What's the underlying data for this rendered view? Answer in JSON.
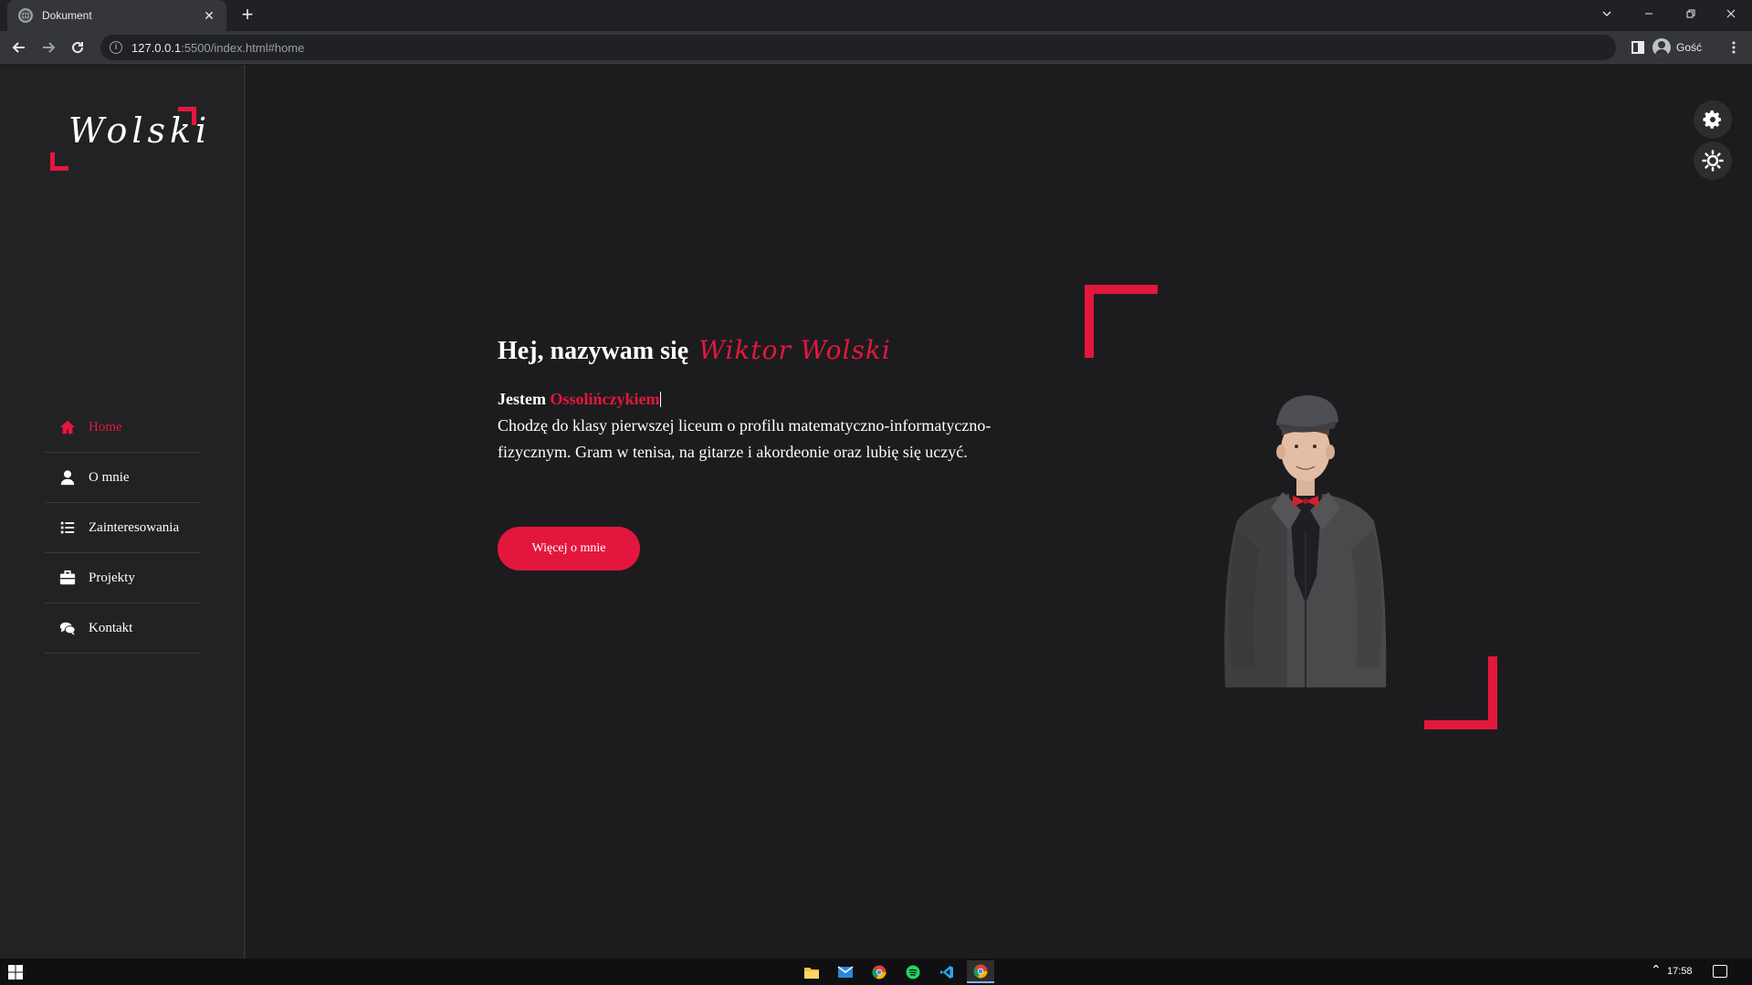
{
  "browser": {
    "tab_title": "Dokument",
    "url_host": "127.0.0.1",
    "url_rest": ":5500/index.html#home",
    "profile_label": "Gość"
  },
  "logo": {
    "text": "Wolski"
  },
  "nav": {
    "items": [
      {
        "label": "Home",
        "icon": "home-icon",
        "active": true
      },
      {
        "label": "O mnie",
        "icon": "user-icon",
        "active": false
      },
      {
        "label": "Zainteresowania",
        "icon": "list-icon",
        "active": false
      },
      {
        "label": "Projekty",
        "icon": "briefcase-icon",
        "active": false
      },
      {
        "label": "Kontakt",
        "icon": "chat-icon",
        "active": false
      }
    ]
  },
  "hero": {
    "greeting": "Hej, nazywam się",
    "name": "Wiktor Wolski",
    "intro_prefix": "Jestem",
    "intro_highlight": "Ossolińczykiem",
    "description": "Chodzę do klasy pierwszej liceum o profilu matematyczno-informatyczno-fizycznym. Gram w tenisa, na gitarze i akordeonie oraz lubię się uczyć.",
    "button_label": "Więcej o mnie"
  },
  "colors": {
    "accent": "#e3173e",
    "background": "#1c1c1e",
    "sidebar": "#222224"
  },
  "taskbar": {
    "clock": "17:58"
  }
}
